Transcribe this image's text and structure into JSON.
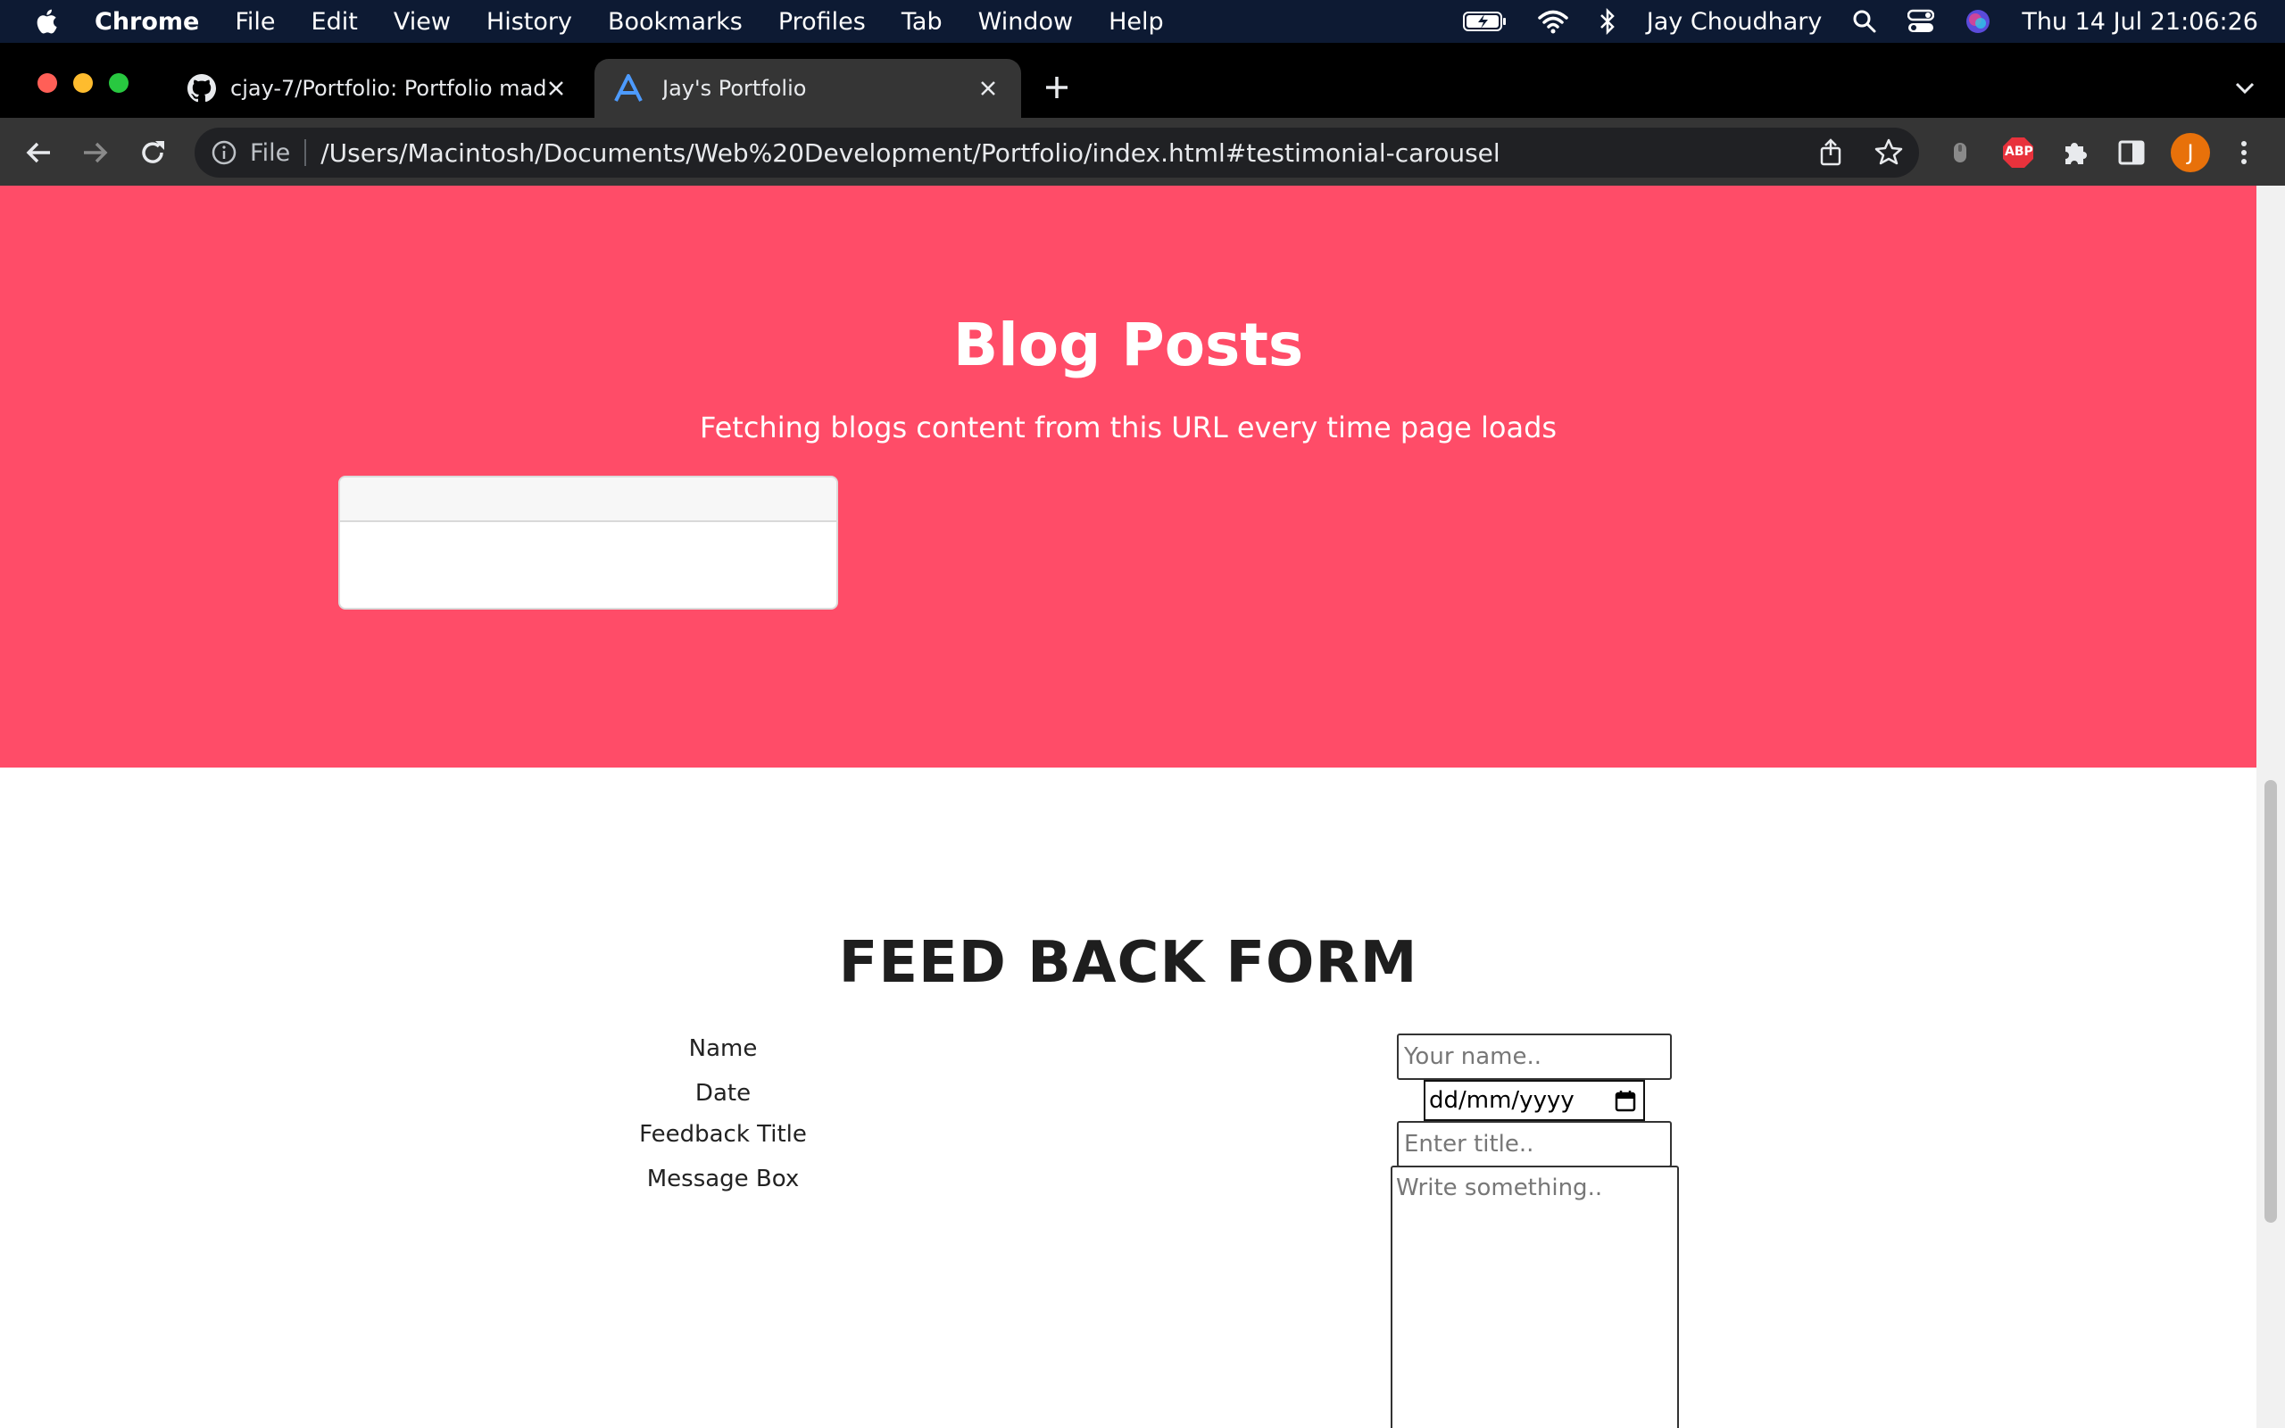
{
  "menubar": {
    "items": [
      "Chrome",
      "File",
      "Edit",
      "View",
      "History",
      "Bookmarks",
      "Profiles",
      "Tab",
      "Window",
      "Help"
    ],
    "user": "Jay Choudhary",
    "datetime": "Thu 14 Jul  21:06:26"
  },
  "tabs": [
    {
      "title": "cjay-7/Portfolio: Portfolio made",
      "icon": "github-icon"
    },
    {
      "title": "Jay's Portfolio",
      "icon": "portfolio-favicon"
    }
  ],
  "omnibox": {
    "scheme_label": "File",
    "url": "/Users/Macintosh/Documents/Web%20Development/Portfolio/index.html#testimonial-carousel"
  },
  "toolbar": {
    "abp_label": "ABP",
    "profile_initial": "J"
  },
  "blog": {
    "title": "Blog Posts",
    "subtitle": "Fetching blogs content from this URL every time page loads"
  },
  "feedback": {
    "title": "FEED BACK FORM",
    "name_label": "Name",
    "name_placeholder": "Your name..",
    "date_label": "Date",
    "date_placeholder": "dd/mm/yyyy",
    "title_label": "Feedback Title",
    "title_placeholder": "Enter title..",
    "message_label": "Message Box",
    "message_placeholder": "Write something.."
  },
  "colors": {
    "blog_bg": "#ff4c68",
    "menubar_bg": "#0d1a33",
    "toolbar_bg": "#353535"
  }
}
